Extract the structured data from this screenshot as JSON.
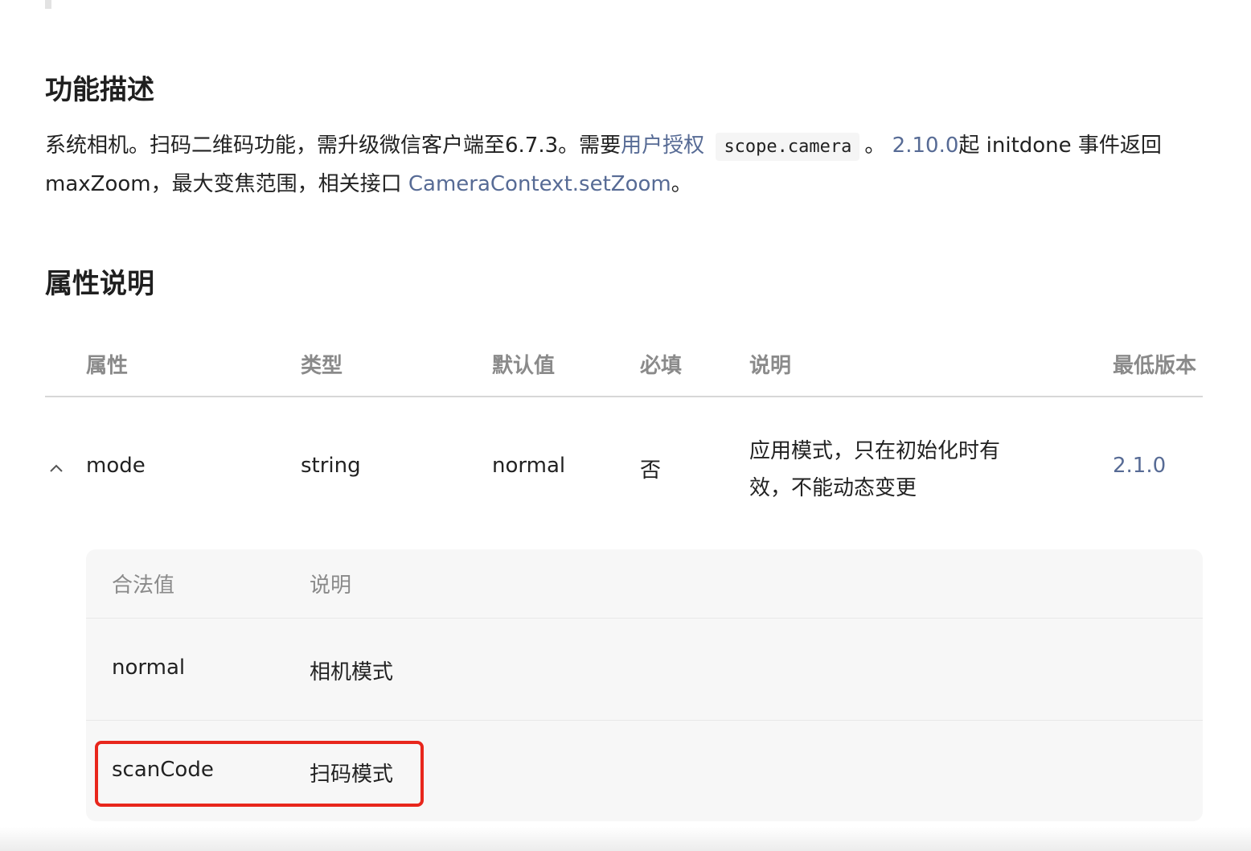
{
  "description_section": {
    "heading": "功能描述",
    "text_1": "系统相机。扫码二维码功能，需升级微信客户端至6.7.3。需要",
    "auth_link": "用户授权",
    "scope_code": "scope.camera",
    "text_2": "。",
    "version_link": "2.10.0",
    "text_3": "起 initdone 事件返回 maxZoom，最大变焦范围，相关接口 ",
    "api_link": "CameraContext.setZoom",
    "text_4": "。"
  },
  "attributes_section": {
    "heading": "属性说明",
    "columns": {
      "attr": "属性",
      "type": "类型",
      "default": "默认值",
      "required": "必填",
      "note": "说明",
      "min_version": "最低版本"
    },
    "rows": [
      {
        "attr": "mode",
        "type": "string",
        "default": "normal",
        "required": "否",
        "note": "应用模式，只在初始化时有效，不能动态变更",
        "min_version": "2.1.0",
        "expanded": true
      }
    ],
    "legal_values": {
      "header_value": "合法值",
      "header_note": "说明",
      "rows": [
        {
          "value": "normal",
          "note": "相机模式"
        },
        {
          "value": "scanCode",
          "note": "扫码模式",
          "highlighted": true
        }
      ]
    }
  },
  "colors": {
    "link": "#576b95",
    "highlight": "#e8261c",
    "muted": "#8a8a8a"
  }
}
